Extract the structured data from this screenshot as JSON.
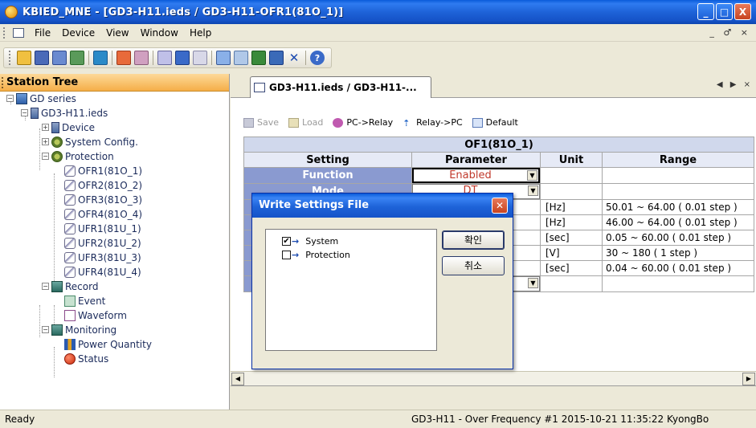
{
  "window": {
    "title": "KBIED_MNE - [GD3-H11.ieds / GD3-H11-OFR1(81O_1)]",
    "minimize": "_",
    "maximize": "□",
    "close": "X"
  },
  "menu": {
    "items": [
      "File",
      "Device",
      "View",
      "Window",
      "Help"
    ],
    "mdi_controls": "_ ♂ ×"
  },
  "sidebar": {
    "title": "Station Tree",
    "root": "GD series",
    "file": "GD3-H11.ieds",
    "device": "Device",
    "system_config": "System Config.",
    "protection": "Protection",
    "protection_items": [
      "OFR1(81O_1)",
      "OFR2(81O_2)",
      "OFR3(81O_3)",
      "OFR4(81O_4)",
      "UFR1(81U_1)",
      "UFR2(81U_2)",
      "UFR3(81U_3)",
      "UFR4(81U_4)"
    ],
    "record": "Record",
    "event": "Event",
    "waveform": "Waveform",
    "monitoring": "Monitoring",
    "power_quantity": "Power Quantity",
    "status": "Status"
  },
  "tabs": {
    "active": "GD3-H11.ieds / GD3-H11-...",
    "nav": "◀ ▶ ×"
  },
  "actions": {
    "save": "Save",
    "load": "Load",
    "pc_to_relay": "PC->Relay",
    "relay_to_pc": "Relay->PC",
    "default": "Default"
  },
  "table": {
    "group_title": "OF1(81O_1)",
    "headers": [
      "Setting",
      "Parameter",
      "Unit",
      "Range"
    ],
    "function_setting": "Function",
    "function_value": "Enabled",
    "mode_setting": "Mode",
    "mode_value": "DT",
    "rows": [
      {
        "unit": "[Hz]",
        "range": "50.01 ~ 64.00 ( 0.01 step )"
      },
      {
        "unit": "[Hz]",
        "range": "46.00 ~ 64.00 ( 0.01 step )"
      },
      {
        "unit": "[sec]",
        "range": "0.05 ~ 60.00 ( 0.01 step )"
      },
      {
        "unit": "[V]",
        "range": "30 ~ 180 ( 1 step )"
      },
      {
        "unit": "[sec]",
        "range": "0.04 ~ 60.00 ( 0.01 step )"
      }
    ]
  },
  "dialog": {
    "title": "Write Settings File",
    "items": [
      {
        "label": "System",
        "checked": "✔"
      },
      {
        "label": "Protection",
        "checked": ""
      }
    ],
    "ok": "확인",
    "cancel": "취소"
  },
  "status": {
    "left": "Ready",
    "right": "GD3-H11 - Over Frequency #1  2015-10-21 11:35:22  KyongBo"
  },
  "colors": {
    "titlebar": "#1e63d8",
    "tree_header": "#f5ae48",
    "setting_cell": "#8a9ad0",
    "enabled_text": "#c0392b"
  }
}
